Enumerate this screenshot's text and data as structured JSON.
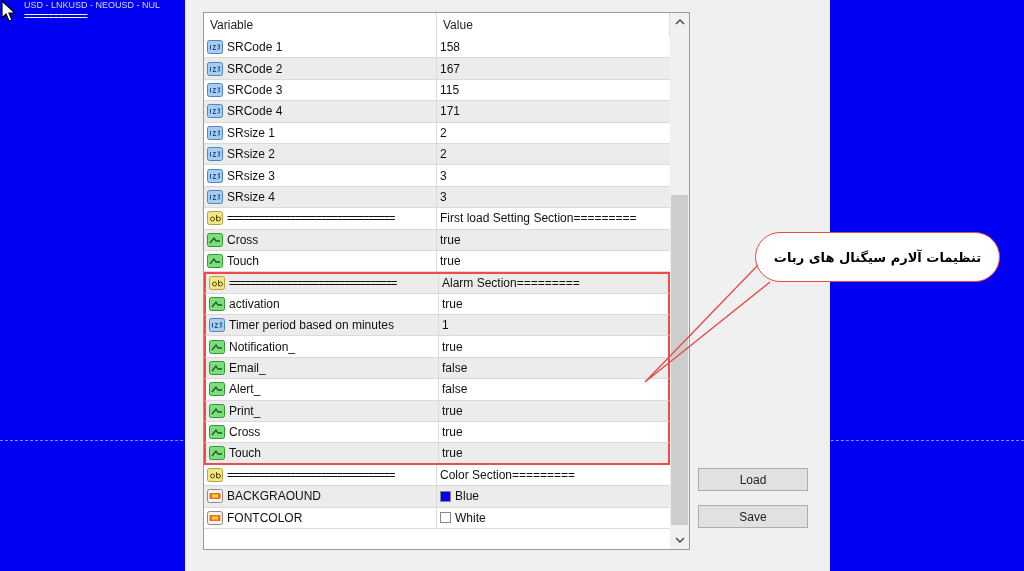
{
  "chart_background": {
    "symbols_text": "USD - LNKUSD - NEOUSD - NUL",
    "separator_text": "============="
  },
  "table": {
    "columns": [
      "Variable",
      "Value"
    ],
    "rows": [
      {
        "kind": "int",
        "variable": "SRCode 1",
        "value": "158",
        "highlighted": false
      },
      {
        "kind": "int",
        "variable": "SRCode 2",
        "value": "167",
        "highlighted": false
      },
      {
        "kind": "int",
        "variable": "SRCode 3",
        "value": "115",
        "highlighted": false
      },
      {
        "kind": "int",
        "variable": "SRCode 4",
        "value": "171",
        "highlighted": false
      },
      {
        "kind": "int",
        "variable": "SRsize 1",
        "value": "2",
        "highlighted": false
      },
      {
        "kind": "int",
        "variable": "SRsize 2",
        "value": "2",
        "highlighted": false
      },
      {
        "kind": "int",
        "variable": "SRsize 3",
        "value": "3",
        "highlighted": false
      },
      {
        "kind": "int",
        "variable": "SRsize 4",
        "value": "3",
        "highlighted": false
      },
      {
        "kind": "string",
        "variable": "================================",
        "value": "First load Setting Section=========",
        "highlighted": false
      },
      {
        "kind": "bool",
        "variable": "Cross",
        "value": "true",
        "highlighted": false
      },
      {
        "kind": "bool",
        "variable": "Touch",
        "value": "true",
        "highlighted": false
      },
      {
        "kind": "string",
        "variable": "================================",
        "value": "Alarm Section=========",
        "highlighted": true
      },
      {
        "kind": "bool",
        "variable": "activation",
        "value": "true",
        "highlighted": true
      },
      {
        "kind": "int",
        "variable": "Timer period based on minutes",
        "value": "1",
        "highlighted": true
      },
      {
        "kind": "bool",
        "variable": "Notification_",
        "value": "true",
        "highlighted": true
      },
      {
        "kind": "bool",
        "variable": "Email_",
        "value": "false",
        "highlighted": true
      },
      {
        "kind": "bool",
        "variable": "Alert_",
        "value": "false",
        "highlighted": true
      },
      {
        "kind": "bool",
        "variable": "Print_",
        "value": "true",
        "highlighted": true
      },
      {
        "kind": "bool",
        "variable": "Cross",
        "value": "true",
        "highlighted": true
      },
      {
        "kind": "bool",
        "variable": "Touch",
        "value": "true",
        "highlighted": true
      },
      {
        "kind": "string",
        "variable": "================================",
        "value": "Color Section=========",
        "highlighted": false
      },
      {
        "kind": "color",
        "variable": "BACKGRAOUND",
        "value": "Blue",
        "color": "#0000ff",
        "highlighted": false
      },
      {
        "kind": "color",
        "variable": "FONTCOLOR",
        "value": "White",
        "color": "#ffffff",
        "highlighted": false
      }
    ]
  },
  "buttons": [
    "Load",
    "Save"
  ],
  "callout": {
    "text": "تنظیمات آلارم سیگنال های ربات"
  }
}
